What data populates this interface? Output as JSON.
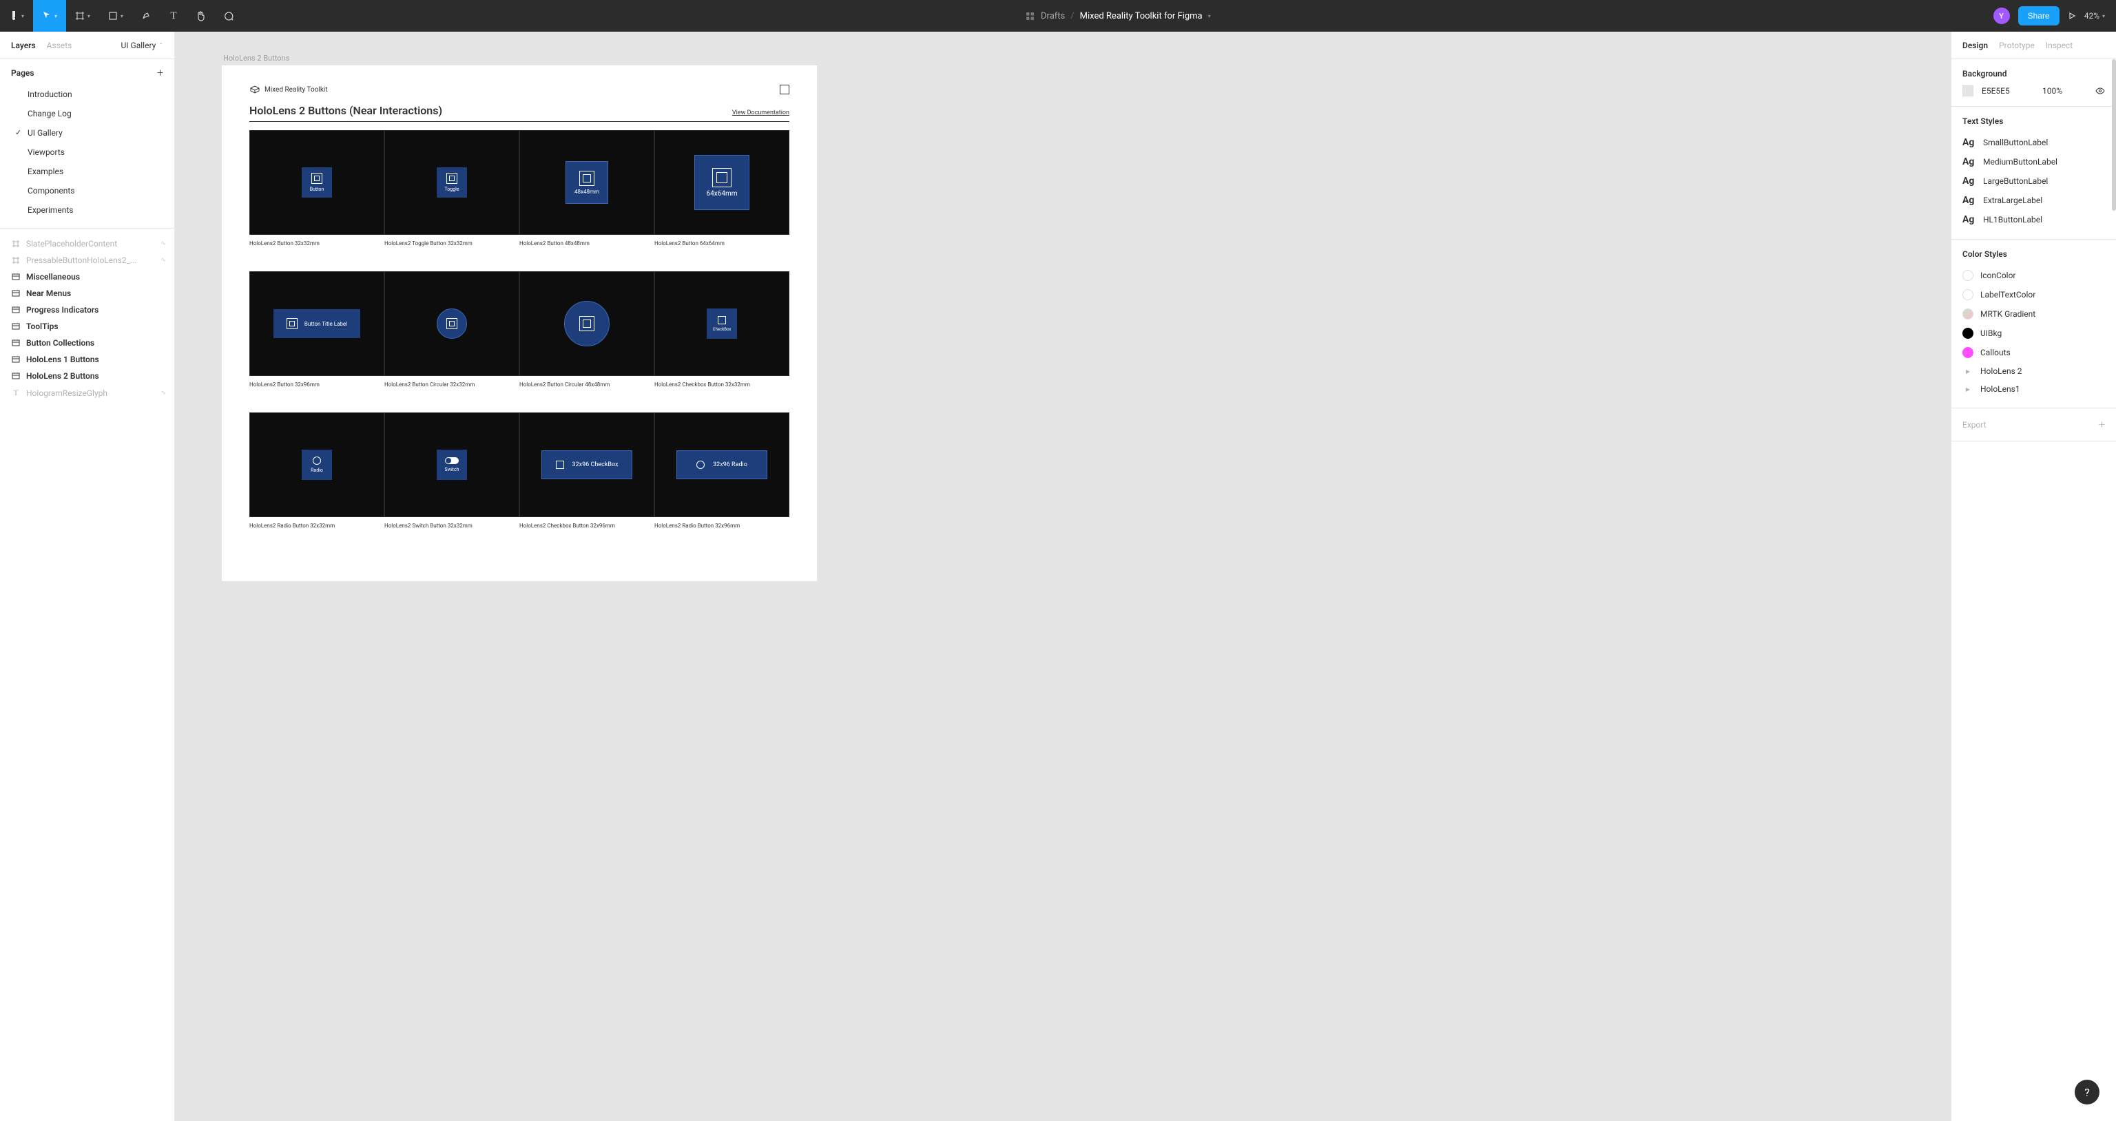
{
  "topbar": {
    "location": "Drafts",
    "filename": "Mixed Reality Toolkit for Figma",
    "avatar_letter": "Y",
    "share_label": "Share",
    "zoom": "42%"
  },
  "left": {
    "tabs": {
      "layers": "Layers",
      "assets": "Assets"
    },
    "page_selector": "UI Gallery",
    "pages_header": "Pages",
    "pages": [
      {
        "label": "Introduction"
      },
      {
        "label": "Change Log"
      },
      {
        "label": "UI Gallery",
        "selected": true
      },
      {
        "label": "Viewports"
      },
      {
        "label": "Examples"
      },
      {
        "label": "Components"
      },
      {
        "label": "Experiments"
      }
    ],
    "layers": [
      {
        "label": "SlatePlaceholderContent",
        "icon": "hash",
        "faded": true,
        "bold": false,
        "action": true
      },
      {
        "label": "PressableButtonHoloLens2_...",
        "icon": "hash",
        "faded": true,
        "bold": false,
        "action": true
      },
      {
        "label": "Miscellaneous",
        "icon": "frame",
        "faded": false,
        "bold": true,
        "action": false
      },
      {
        "label": "Near Menus",
        "icon": "frame",
        "faded": false,
        "bold": true,
        "action": false
      },
      {
        "label": "Progress Indicators",
        "icon": "frame",
        "faded": false,
        "bold": true,
        "action": false
      },
      {
        "label": "ToolTips",
        "icon": "frame",
        "faded": false,
        "bold": true,
        "action": false
      },
      {
        "label": "Button Collections",
        "icon": "frame",
        "faded": false,
        "bold": true,
        "action": false
      },
      {
        "label": "HoloLens 1 Buttons",
        "icon": "frame",
        "faded": false,
        "bold": true,
        "action": false
      },
      {
        "label": "HoloLens 2 Buttons",
        "icon": "frame",
        "faded": false,
        "bold": true,
        "action": false
      },
      {
        "label": "HologramResizeGlyph",
        "icon": "text",
        "faded": true,
        "bold": false,
        "action": true
      }
    ]
  },
  "canvas": {
    "frame_label": "HoloLens 2 Buttons",
    "toolkit_name": "Mixed Reality Toolkit",
    "section_title": "HoloLens 2 Buttons  (Near Interactions)",
    "doc_link": "View Documentation",
    "rows": [
      [
        {
          "caption": "HoloLens2 Button 32x32mm",
          "button_label": "Button",
          "variant": "sq32"
        },
        {
          "caption": "HoloLens2 Toggle Button 32x32mm",
          "button_label": "Toggle",
          "variant": "sq32"
        },
        {
          "caption": "HoloLens2 Button 48x48mm",
          "button_label": "48x48mm",
          "variant": "sq48"
        },
        {
          "caption": "HoloLens2 Button 64x64mm",
          "button_label": "64x64mm",
          "variant": "sq64"
        }
      ],
      [
        {
          "caption": "HoloLens2 Button 32x96mm",
          "button_label": "Button Title Label",
          "variant": "wide96"
        },
        {
          "caption": "HoloLens2 Button Circular 32x32mm",
          "button_label": "",
          "variant": "circ32"
        },
        {
          "caption": "HoloLens2 Button Circular 48x48mm",
          "button_label": "",
          "variant": "circ48"
        },
        {
          "caption": "HoloLens2 Checkbox Button 32x32mm",
          "button_label": "CheckBox",
          "variant": "check32"
        }
      ],
      [
        {
          "caption": "HoloLens2 Radio Button 32x32mm",
          "button_label": "Radio",
          "variant": "radio32"
        },
        {
          "caption": "HoloLens2 Switch Button 32x32mm",
          "button_label": "Switch",
          "variant": "switch32"
        },
        {
          "caption": "HoloLens2 Checkbox Button 32x96mm",
          "button_label": "32x96 CheckBox",
          "variant": "wide-check"
        },
        {
          "caption": "HoloLens2 Radio Button 32x96mm",
          "button_label": "32x96 Radio",
          "variant": "wide-radio"
        }
      ]
    ]
  },
  "right": {
    "tabs": {
      "design": "Design",
      "prototype": "Prototype",
      "inspect": "Inspect"
    },
    "background_header": "Background",
    "bg_hex": "E5E5E5",
    "bg_opacity": "100%",
    "text_styles_header": "Text Styles",
    "text_styles": [
      "SmallButtonLabel",
      "MediumButtonLabel",
      "LargeButtonLabel",
      "ExtraLargeLabel",
      "HL1ButtonLabel"
    ],
    "color_styles_header": "Color Styles",
    "color_styles": [
      {
        "label": "IconColor",
        "class": "white"
      },
      {
        "label": "LabelTextColor",
        "class": "white"
      },
      {
        "label": "MRTK Gradient",
        "class": "grad"
      },
      {
        "label": "UIBkg",
        "class": "black"
      },
      {
        "label": "Callouts",
        "class": "pink"
      }
    ],
    "color_groups": [
      "HoloLens 2",
      "HoloLens1"
    ],
    "export_header": "Export"
  },
  "help": "?"
}
